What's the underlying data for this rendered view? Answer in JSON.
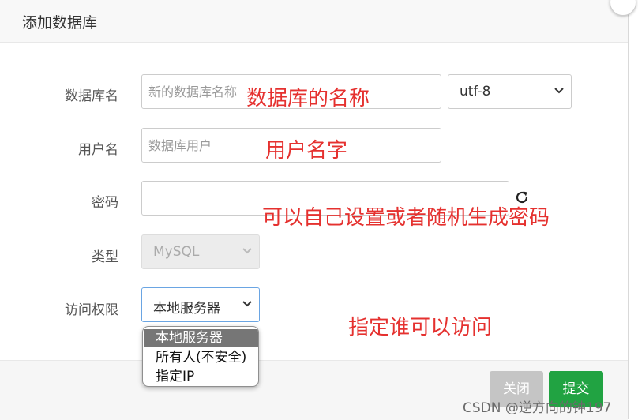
{
  "dialog": {
    "title": "添加数据库",
    "close_label": "关闭",
    "submit_label": "提交"
  },
  "form": {
    "db_name": {
      "label": "数据库名",
      "placeholder": "新的数据库名称",
      "value": ""
    },
    "charset": {
      "value": "utf-8"
    },
    "username": {
      "label": "用户名",
      "placeholder": "数据库用户",
      "value": ""
    },
    "password": {
      "label": "密码",
      "value": ""
    },
    "type": {
      "label": "类型",
      "value": "MySQL"
    },
    "access": {
      "label": "访问权限",
      "value": "本地服务器",
      "options": [
        "本地服务器",
        "所有人(不安全)",
        "指定IP"
      ],
      "selected_index": 0
    }
  },
  "annotations": {
    "db_name_note": "数据库的名称",
    "username_note": "用户名字",
    "password_note": "可以自己设置或者随机生成密码",
    "access_note": "指定谁可以访问"
  },
  "watermark": "CSDN @逆方向的钟197",
  "colors": {
    "annotation": "#e5312f",
    "submit": "#21a342",
    "close": "#c5c5c5"
  },
  "icons": {
    "refresh": "refresh-icon",
    "chevron": "chevron-down-icon"
  }
}
